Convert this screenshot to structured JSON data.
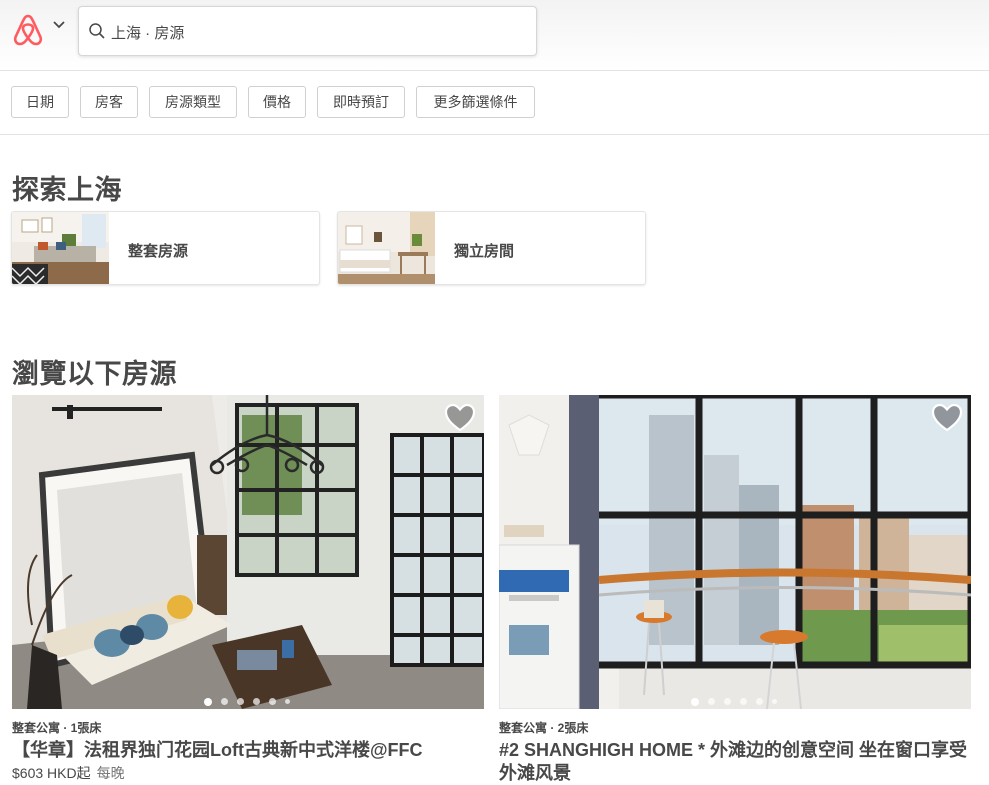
{
  "header": {
    "search_text": "上海 · 房源",
    "logo_icon": "airbnb-logo-icon",
    "brand_color": "#FF5A5F"
  },
  "filters": [
    "日期",
    "房客",
    "房源類型",
    "價格",
    "即時預訂",
    "更多篩選條件"
  ],
  "explore": {
    "title": "探索上海",
    "categories": [
      {
        "label": "整套房源"
      },
      {
        "label": "獨立房間"
      }
    ]
  },
  "browse": {
    "title": "瀏覽以下房源",
    "listings": [
      {
        "meta": "整套公寓 · 1張床",
        "title": "【华章】法租界独门花园Loft古典新中式洋楼@FFC",
        "price": "$603 HKD起",
        "per": "每晚",
        "saved": false,
        "photo_index": 1,
        "photo_count": 6
      },
      {
        "meta": "整套公寓 · 2張床",
        "title": "#2 SHANGHIGH HOME * 外滩边的创意空间 坐在窗口享受外滩风景",
        "price": "",
        "per": "",
        "saved": false,
        "photo_index": 1,
        "photo_count": 6
      }
    ]
  }
}
